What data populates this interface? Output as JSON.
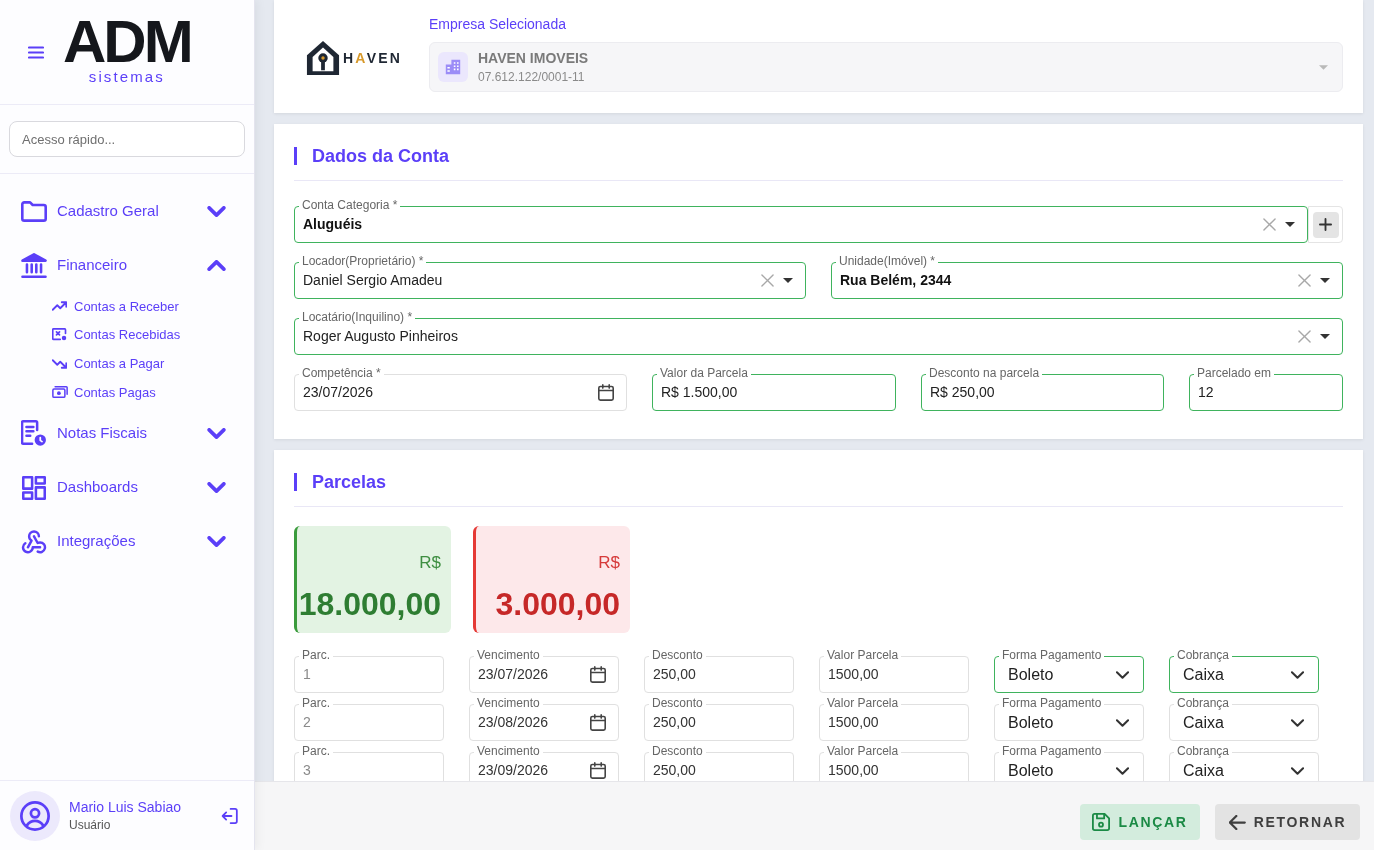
{
  "sidebar": {
    "logo": {
      "text": "ADM",
      "tagline": "sistemas"
    },
    "search": {
      "placeholder": "Acesso rápido..."
    },
    "nav": [
      {
        "label": "Cadastro Geral",
        "expanded": false
      },
      {
        "label": "Financeiro",
        "expanded": true,
        "children": [
          {
            "label": "Contas a Receber"
          },
          {
            "label": "Contas Recebidas"
          },
          {
            "label": "Contas a Pagar"
          },
          {
            "label": "Contas Pagas"
          }
        ]
      },
      {
        "label": "Notas Fiscais",
        "expanded": false
      },
      {
        "label": "Dashboards",
        "expanded": false
      },
      {
        "label": "Integrações",
        "expanded": false
      }
    ],
    "user": {
      "name": "Mario Luis Sabiao",
      "role": "Usuário"
    }
  },
  "company": {
    "logo_text": "HAVEN",
    "label": "Empresa Selecionada",
    "name": "HAVEN IMOVEIS",
    "document": "07.612.122/0001-11",
    "disabled": true
  },
  "account": {
    "title": "Dados da Conta",
    "rows": [
      {
        "add_button": true,
        "fields": [
          {
            "label": "Conta Categoria *",
            "value": "Aluguéis",
            "kind": "combo",
            "valid": true,
            "strong": true
          }
        ]
      },
      {
        "fields": [
          {
            "label": "Locador(Proprietário) *",
            "value": "Daniel Sergio Amadeu",
            "kind": "combo",
            "valid": true,
            "strong": false
          },
          {
            "label": "Unidade(Imóvel) *",
            "value": "Rua Belém, 2344",
            "kind": "combo",
            "valid": true,
            "strong": true
          }
        ]
      },
      {
        "fields": [
          {
            "label": "Locatário(Inquilino) *",
            "value": "Roger Augusto Pinheiros",
            "kind": "combo",
            "valid": true,
            "strong": false
          }
        ]
      },
      {
        "fields": [
          {
            "label": "Competência *",
            "value": "23/07/2026",
            "kind": "date",
            "valid": false,
            "strong": false
          },
          {
            "label": "Valor da Parcela",
            "value": "R$ 1.500,00",
            "kind": "text",
            "valid": true,
            "strong": false
          },
          {
            "label": "Desconto na parcela",
            "value": "R$ 250,00",
            "kind": "text",
            "valid": true,
            "strong": false
          },
          {
            "label": "Parcelado em",
            "value": "12",
            "kind": "text",
            "valid": true,
            "strong": false
          }
        ]
      }
    ]
  },
  "installments": {
    "title": "Parcelas",
    "totals": [
      {
        "kind": "total",
        "currency": "R$",
        "value": "18.000,00"
      },
      {
        "kind": "discount",
        "currency": "R$",
        "value": "3.000,00"
      }
    ],
    "rows": [
      {
        "fields": [
          {
            "label": "Parc.",
            "value": "1",
            "kind": "text",
            "valid": false,
            "disabled": true
          },
          {
            "label": "Vencimento",
            "value": "23/07/2026",
            "kind": "date",
            "valid": false,
            "disabled": false
          },
          {
            "label": "Desconto",
            "value": "250,00",
            "kind": "text",
            "valid": false,
            "disabled": false
          },
          {
            "label": "Valor Parcela",
            "value": "1500,00",
            "kind": "text",
            "valid": false,
            "disabled": false
          },
          {
            "label": "Forma Pagamento",
            "value": "Boleto",
            "kind": "select",
            "valid": true,
            "disabled": false
          },
          {
            "label": "Cobrança",
            "value": "Caixa",
            "kind": "select",
            "valid": true,
            "disabled": false
          }
        ]
      },
      {
        "fields": [
          {
            "label": "Parc.",
            "value": "2",
            "kind": "text",
            "valid": false,
            "disabled": true
          },
          {
            "label": "Vencimento",
            "value": "23/08/2026",
            "kind": "date",
            "valid": false,
            "disabled": false
          },
          {
            "label": "Desconto",
            "value": "250,00",
            "kind": "text",
            "valid": false,
            "disabled": false
          },
          {
            "label": "Valor Parcela",
            "value": "1500,00",
            "kind": "text",
            "valid": false,
            "disabled": false
          },
          {
            "label": "Forma Pagamento",
            "value": "Boleto",
            "kind": "select",
            "valid": false,
            "disabled": false
          },
          {
            "label": "Cobrança",
            "value": "Caixa",
            "kind": "select",
            "valid": false,
            "disabled": false
          }
        ]
      },
      {
        "fields": [
          {
            "label": "Parc.",
            "value": "3",
            "kind": "text",
            "valid": false,
            "disabled": true
          },
          {
            "label": "Vencimento",
            "value": "23/09/2026",
            "kind": "date",
            "valid": false,
            "disabled": false
          },
          {
            "label": "Desconto",
            "value": "250,00",
            "kind": "text",
            "valid": false,
            "disabled": false
          },
          {
            "label": "Valor Parcela",
            "value": "1500,00",
            "kind": "text",
            "valid": false,
            "disabled": false
          },
          {
            "label": "Forma Pagamento",
            "value": "Boleto",
            "kind": "select",
            "valid": false,
            "disabled": false
          },
          {
            "label": "Cobrança",
            "value": "Caixa",
            "kind": "select",
            "valid": false,
            "disabled": false
          }
        ]
      }
    ]
  },
  "actions": [
    {
      "label": "LANÇAR",
      "kind": "save"
    },
    {
      "label": "RETORNAR",
      "kind": "back"
    }
  ]
}
